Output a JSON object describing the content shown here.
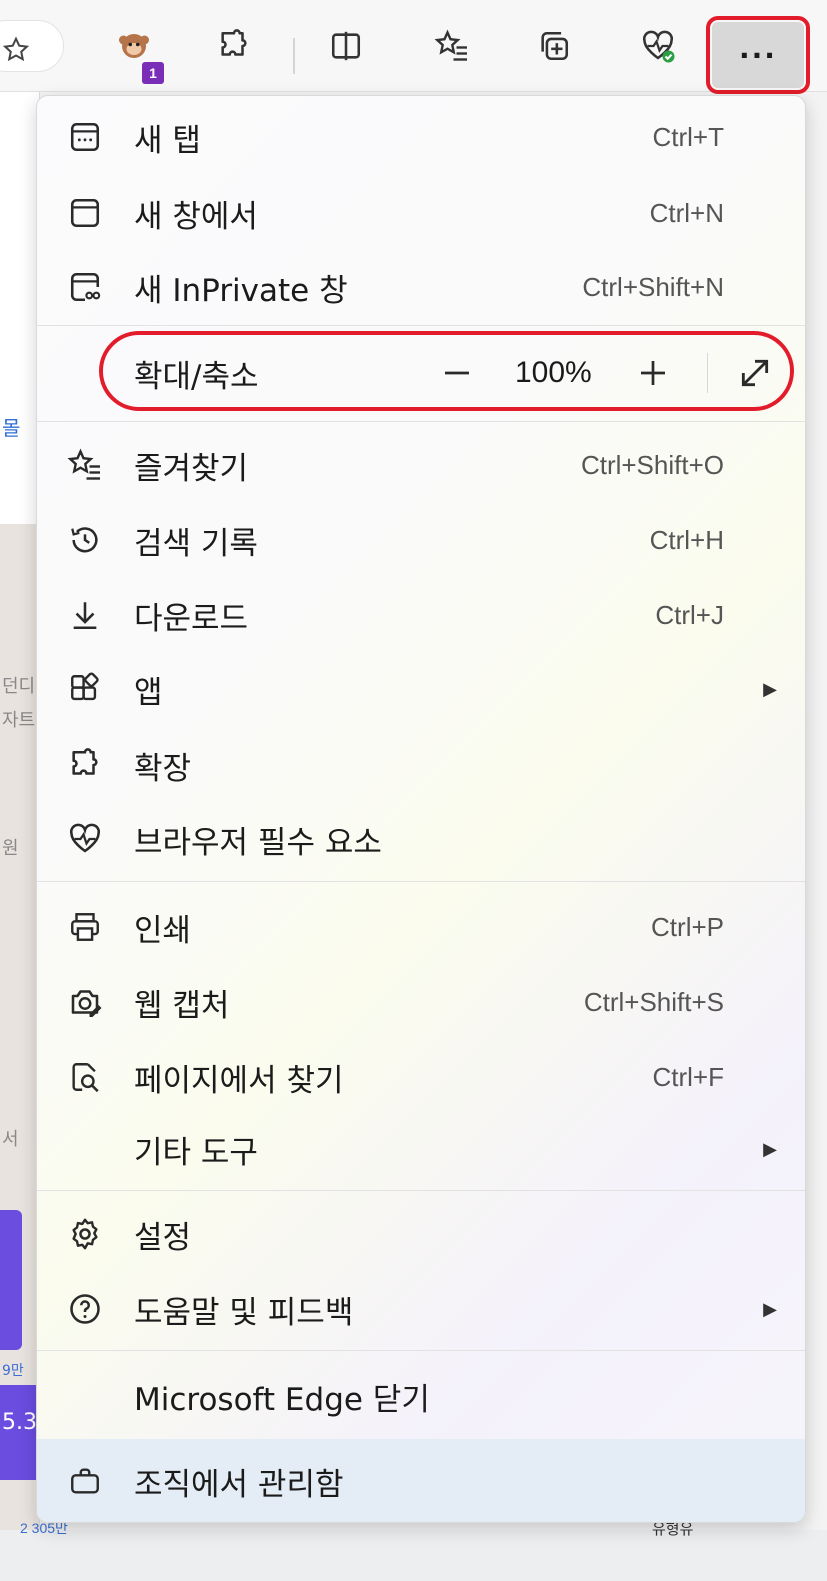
{
  "menu": {
    "items": [
      {
        "label": "새 탭",
        "shortcut": "Ctrl+T"
      },
      {
        "label": "새 창에서",
        "shortcut": "Ctrl+N"
      },
      {
        "label": "새 InPrivate 창",
        "shortcut": "Ctrl+Shift+N"
      },
      {
        "label": "즐겨찾기",
        "shortcut": "Ctrl+Shift+O"
      },
      {
        "label": "검색 기록",
        "shortcut": "Ctrl+H"
      },
      {
        "label": "다운로드",
        "shortcut": "Ctrl+J"
      },
      {
        "label": "앱",
        "shortcut": ""
      },
      {
        "label": "확장",
        "shortcut": ""
      },
      {
        "label": "브라우저 필수 요소",
        "shortcut": ""
      },
      {
        "label": "인쇄",
        "shortcut": "Ctrl+P"
      },
      {
        "label": "웹 캡처",
        "shortcut": "Ctrl+Shift+S"
      },
      {
        "label": "페이지에서 찾기",
        "shortcut": "Ctrl+F"
      },
      {
        "label": "기타 도구",
        "shortcut": ""
      },
      {
        "label": "설정",
        "shortcut": ""
      },
      {
        "label": "도움말 및 피드백",
        "shortcut": ""
      },
      {
        "label": "Microsoft Edge 닫기",
        "shortcut": ""
      },
      {
        "label": "조직에서 관리함",
        "shortcut": ""
      }
    ],
    "zoom": {
      "label": "확대/축소",
      "value": "100%"
    }
  },
  "toolbar": {
    "more_label": "···",
    "extension_badge": "1"
  },
  "background": {
    "fragments": [
      "몰",
      "던디",
      "자트",
      "원",
      "서",
      "9만",
      "5.3",
      "2 305만",
      "유형유"
    ]
  },
  "colors": {
    "highlight_ring": "#e21c2a",
    "badge": "#7a2eb8",
    "managed_bg": "#e4ecf5"
  }
}
